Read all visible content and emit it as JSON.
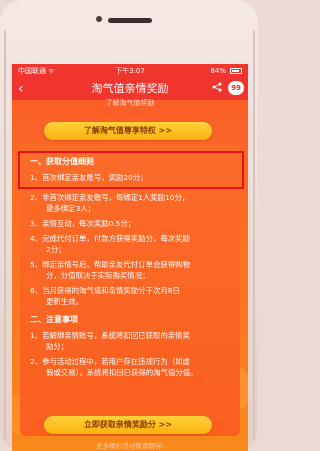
{
  "status_bar": {
    "carrier": "中国联通 ᯤ",
    "time": "下午3:07",
    "battery_percent": "84%"
  },
  "nav": {
    "back_symbol": "‹",
    "title": "淘气值亲情奖励",
    "notification_count": "99"
  },
  "top_hint": "了解淘气值奖励",
  "learn_more_button": "了解淘气值尊享特权 >>",
  "rules": {
    "section1_title": "一、获取分值细则",
    "item1": "1、首次绑定亲友账号，奖励20分；",
    "item2_line1": "2、非首次绑定亲友账号，每绑定1人奖励10分，",
    "item2_line2": "最多绑定3人；",
    "item3": "3、亲情互动，每次奖励0.5分；",
    "item4_line1": "4、完成代付订单，付款方获得奖励分，每次奖励",
    "item4_line2": "2分；",
    "item5_line1": "5、绑定亲情号后，帮助亲友代付订单会获得购物",
    "item5_line2": "分，分值取决于实际购买情况；",
    "item6_line1": "6、当月获得的淘气值和亲情奖励分于次月8日",
    "item6_line2": "更新生效。",
    "section2_title": "二、注意事项",
    "note1_line1": "1、若解绑亲情账号，系统将扣回已获取的亲情奖",
    "note1_line2": "励分；",
    "note2_line1": "2、参与活动过程中，若用户存在违规行为（如虚",
    "note2_line2": "假或交易），系统将扣回已获得的淘气值分值。"
  },
  "claim_button": "立即获取亲情奖励分 >>",
  "footer_text": "更多精彩活动敬请期待!",
  "colors": {
    "header_red": "#f0352f",
    "background_orange": "#fa6a25",
    "button_yellow": "#ffd23a",
    "highlight_border": "#e5121a"
  }
}
